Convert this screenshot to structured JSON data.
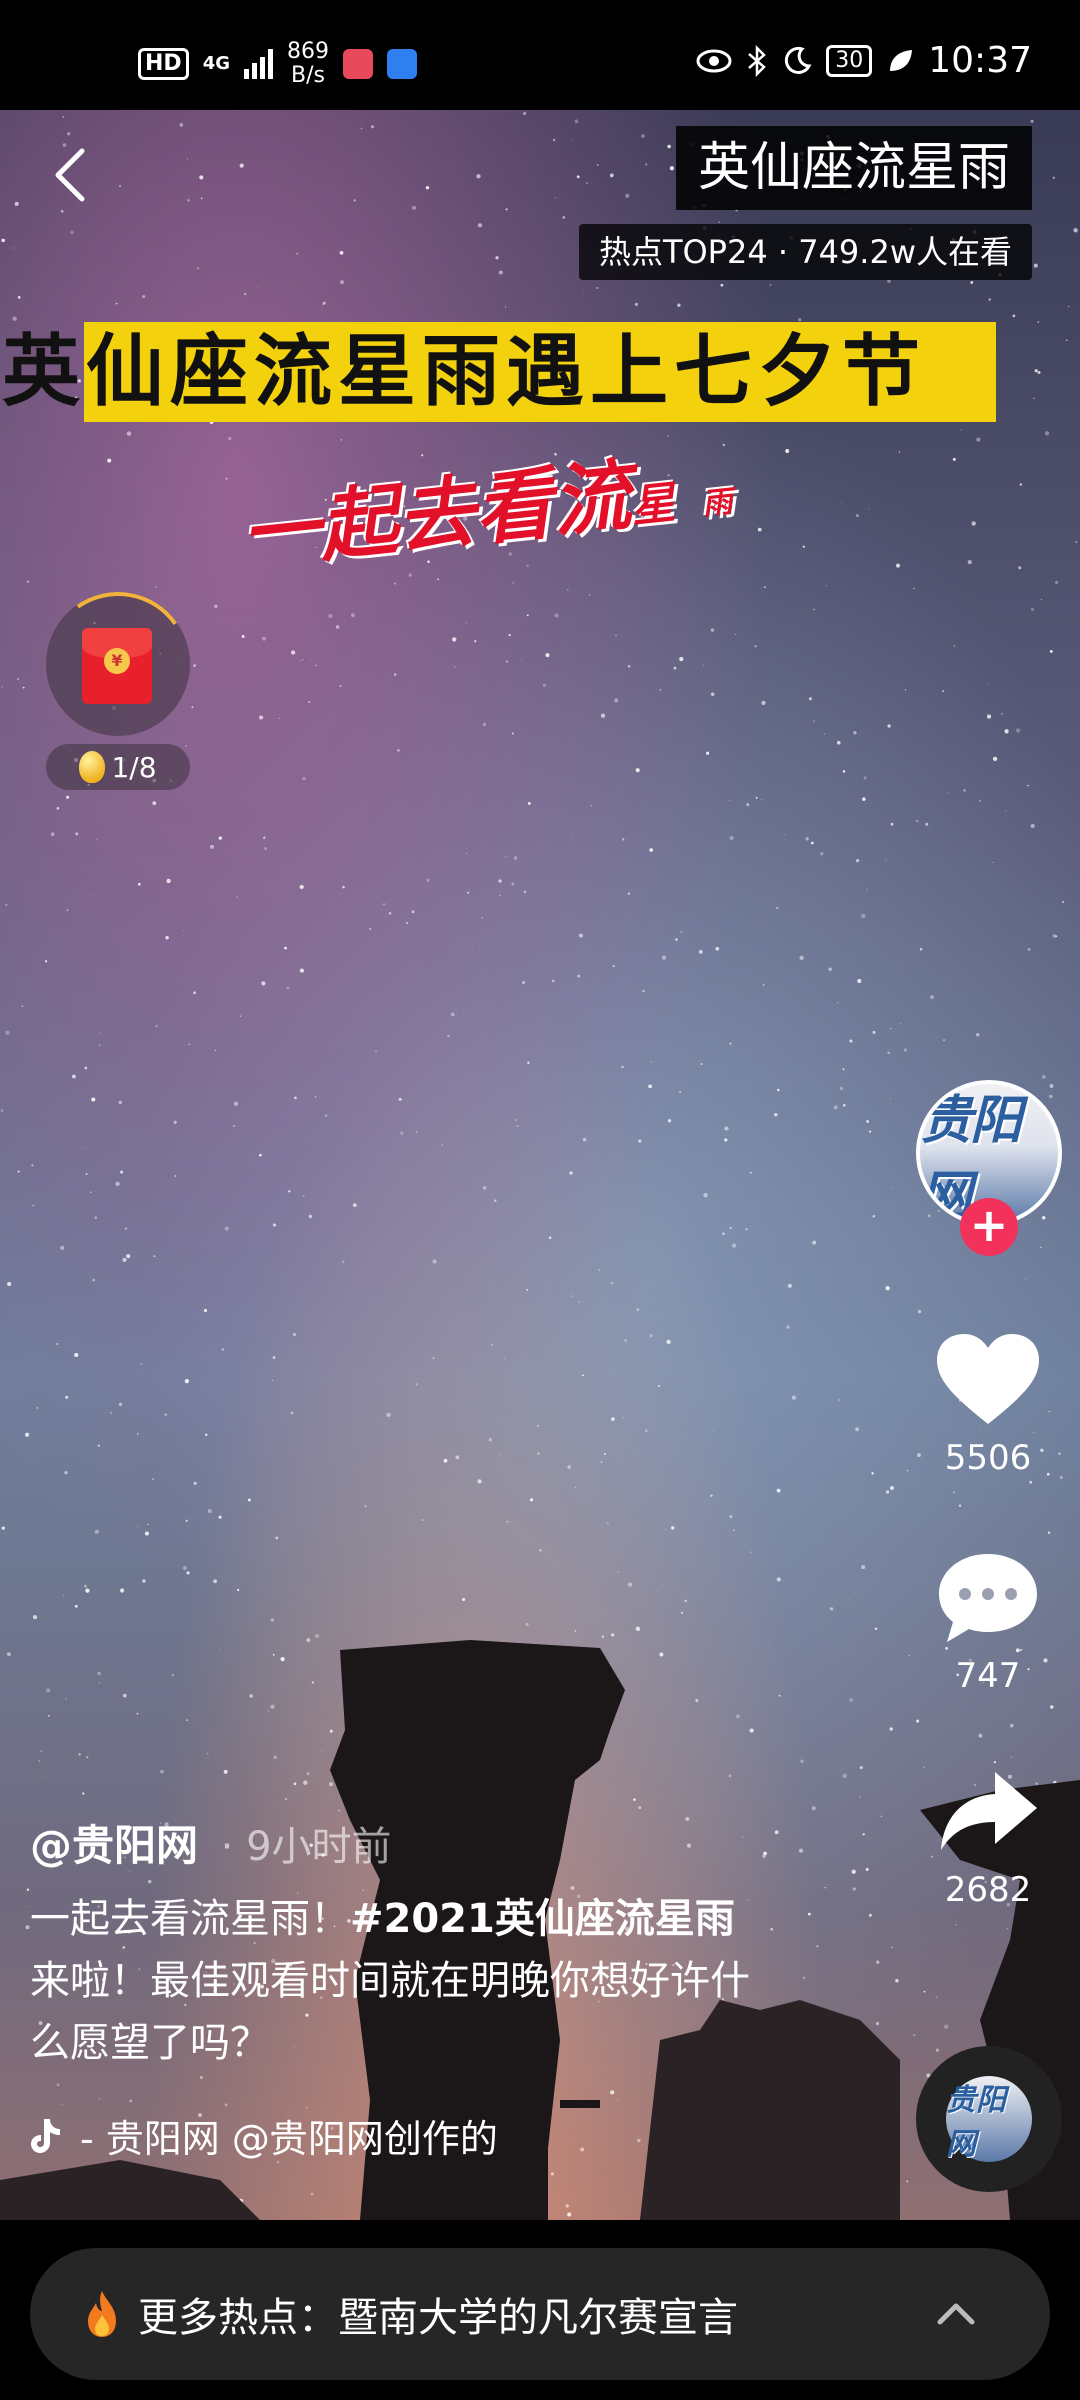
{
  "status_bar": {
    "hd": "HD",
    "network": "4G",
    "speed_value": "869",
    "speed_unit": "B/s",
    "battery": "30",
    "time": "10:37"
  },
  "video": {
    "title": "英仙座流星雨",
    "hot_info": "热点TOP24 · 749.2w人在看",
    "headline": "英仙座流星雨遇上七夕节",
    "overlay_art_big": "一起去看流",
    "overlay_art_mid": "星",
    "overlay_art_small": "雨"
  },
  "red_packet": {
    "coin_glyph": "¥",
    "progress": "1/8"
  },
  "author": {
    "avatar_text": "贵阳网",
    "follow_glyph": "+"
  },
  "actions": {
    "likes": "5506",
    "comments": "747",
    "shares": "2682"
  },
  "caption": {
    "author": "@贵阳网",
    "time_ago": "· 9小时前",
    "text_before": "一起去看流星雨！",
    "hashtag": "#2021英仙座流星雨",
    "text_after": " 来啦！最佳观看时间就在明晚你想好许什么愿望了吗？"
  },
  "music": {
    "label": "- 贵阳网   @贵阳网创作的"
  },
  "disc_text": "贵阳网",
  "hot_bar": {
    "label": "更多热点：暨南大学的凡尔赛宣言"
  },
  "icons": [
    "back-arrow-icon",
    "heart-icon",
    "comment-icon",
    "share-icon",
    "tiktok-note-icon",
    "flame-icon",
    "chevron-up-icon"
  ]
}
